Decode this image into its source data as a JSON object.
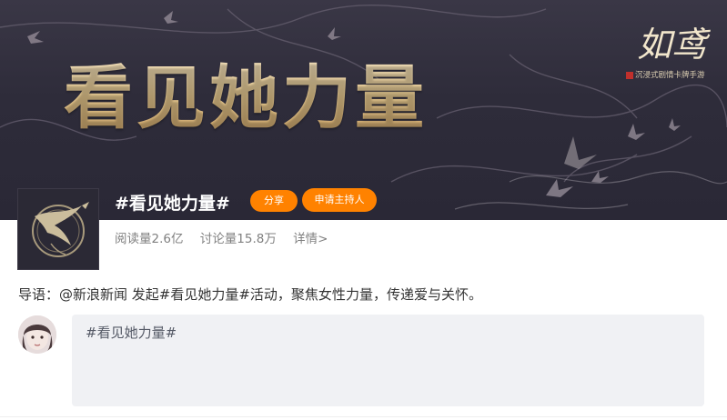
{
  "banner": {
    "headline": "看见她力量",
    "brand_logo_text": "如鸢",
    "brand_logo_sub": "沉浸式剧情卡牌手游"
  },
  "topic": {
    "title": "#看见她力量#",
    "share_label": "分享",
    "host_label": "申请主持人",
    "reads": "阅读量2.6亿",
    "discussions": "讨论量15.8万",
    "details": "详情>"
  },
  "intro": {
    "prefix": "导语：",
    "sponsor": "@新浪新闻",
    "text": " 发起#看见她力量#活动，聚焦女性力量，传递爱与关怀。"
  },
  "compose": {
    "value": "#看见她力量#"
  },
  "colors": {
    "accent": "#ff8200",
    "banner_bg": "#2e2c3a",
    "gold": "#e7c98f",
    "compose_bg": "#f0f1f4"
  },
  "icons": [
    "bird-emblem-icon",
    "user-avatar"
  ]
}
